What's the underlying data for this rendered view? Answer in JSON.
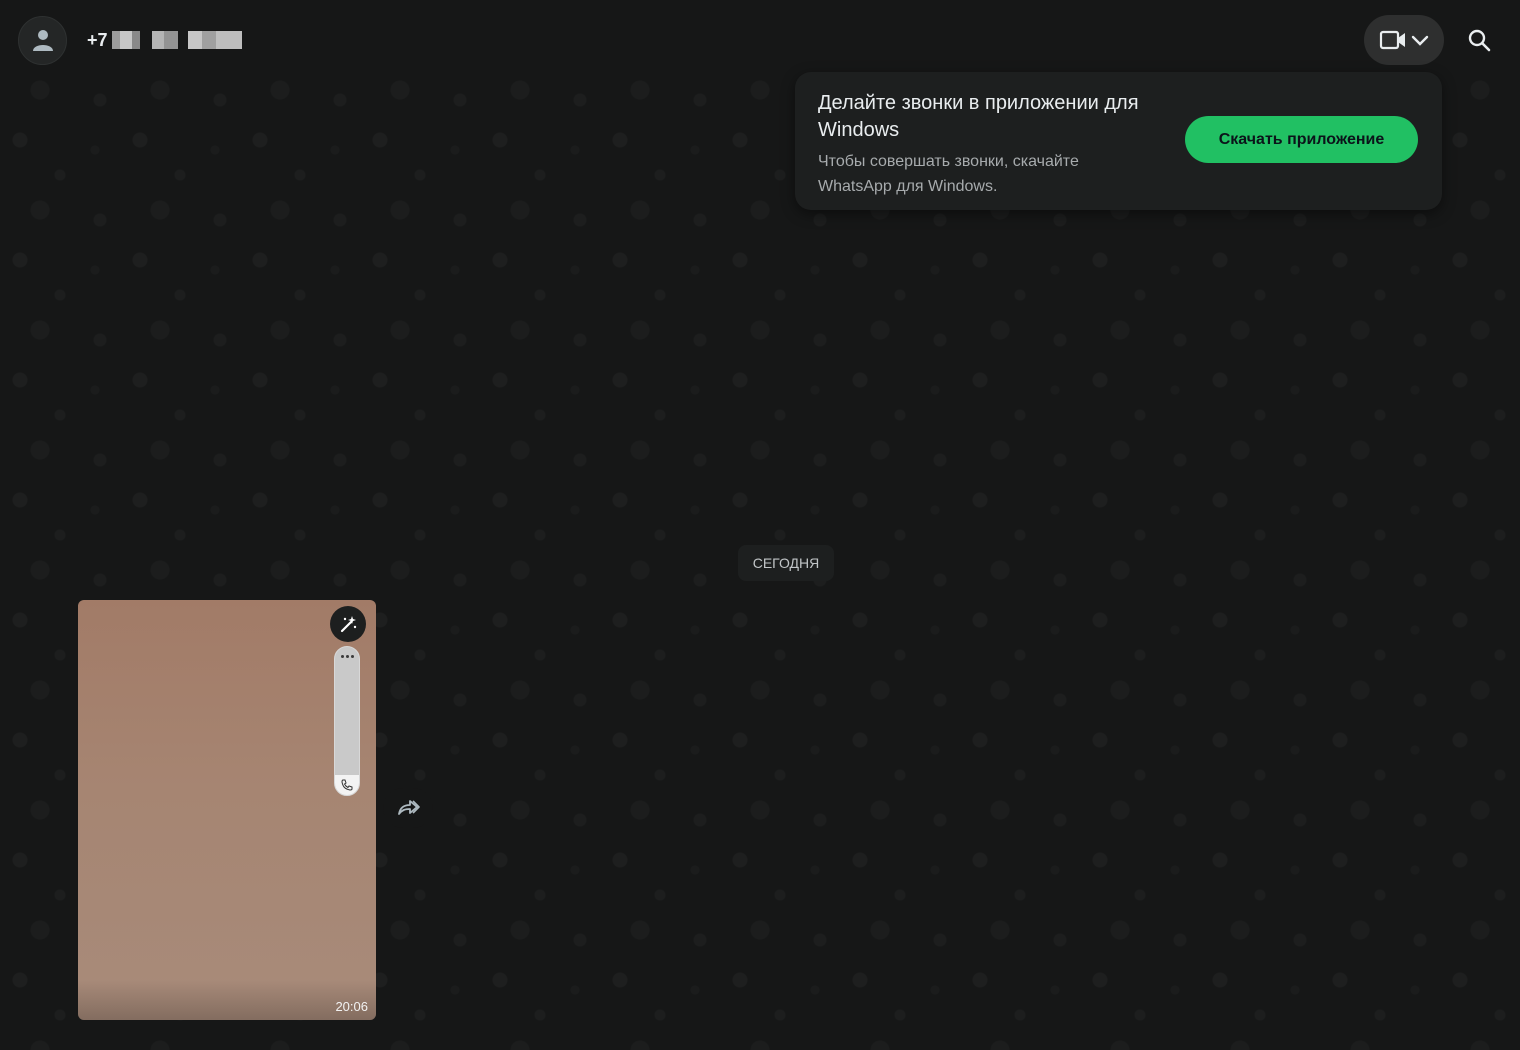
{
  "header": {
    "contact_prefix": "+7",
    "avatar_icon": "default-avatar-icon",
    "video_icon": "video-camera-icon",
    "dropdown_icon": "chevron-down-icon",
    "search_icon": "search-icon"
  },
  "popup": {
    "title": "Делайте звонки в приложении для Windows",
    "text": "Чтобы совершать звонки, скачайте WhatsApp для Windows.",
    "button_label": "Скачать приложение"
  },
  "chat": {
    "date_label": "СЕГОДНЯ",
    "messages": [
      {
        "type": "image",
        "time": "20:06"
      }
    ],
    "forward_icon": "forward-icon"
  },
  "colors": {
    "accent": "#21c063",
    "background": "#161717",
    "panel": "#1d1f1f",
    "text_primary": "#e9edef",
    "text_secondary": "#a7abad"
  }
}
